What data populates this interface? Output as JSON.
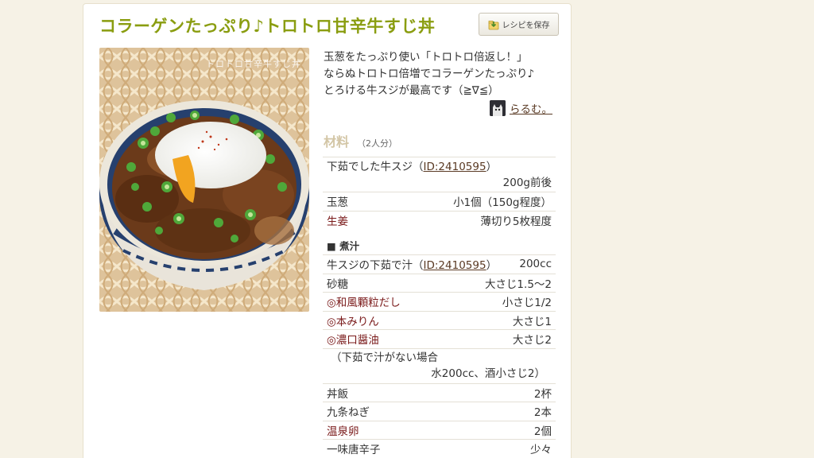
{
  "recipe": {
    "title": "コラーゲンたっぷり♪トロトロ甘辛牛すじ丼",
    "save_label": "レシピを保存",
    "photo_caption": "トロトロ甘辛牛すじ丼",
    "description": [
      "玉葱をたっぷり使い「トロトロ倍返し！」",
      "ならぬトロトロ倍増でコラーゲンたっぷり♪",
      "とろける牛スジが最高です（≧∇≦）"
    ],
    "author": "らるむ。",
    "ingredients_title": "材料",
    "servings": "（2人分）",
    "ingredients": [
      {
        "name": "下茹でした牛スジ（",
        "link": "ID:2410595",
        "name_after": "）",
        "amount": "200g前後",
        "tall": true
      },
      {
        "name": "玉葱",
        "amount": "小1個（150g程度）"
      },
      {
        "name": "生姜",
        "amount": "薄切り5枚程度",
        "red": true
      }
    ],
    "section_label": "■ 煮汁",
    "sauce": [
      {
        "name": "牛スジの下茹で汁（",
        "link": "ID:2410595",
        "name_after": "）",
        "amount": "200cc"
      },
      {
        "name": "砂糖",
        "amount": "大さじ1.5〜2"
      },
      {
        "name": "◎和風顆粒だし",
        "amount": "小さじ1/2",
        "red": true
      },
      {
        "name": "◎本みりん",
        "amount": "大さじ1",
        "red": true
      },
      {
        "name": "◎濃口醤油",
        "amount": "大さじ2",
        "red": true
      }
    ],
    "note": {
      "line1": "（下茹で汁がない場合",
      "line2": "水200cc、酒小さじ2）"
    },
    "extras": [
      {
        "name": "丼飯",
        "amount": "2杯"
      },
      {
        "name": "九条ねぎ",
        "amount": "2本"
      },
      {
        "name": "温泉卵",
        "amount": "2個",
        "red": true
      },
      {
        "name": "一味唐辛子",
        "amount": "少々"
      }
    ]
  },
  "colors": {
    "title": "#8a9d10",
    "background": "#f6f2e6",
    "link": "#5a3a24",
    "ingredient_red": "#7a1a1a"
  }
}
